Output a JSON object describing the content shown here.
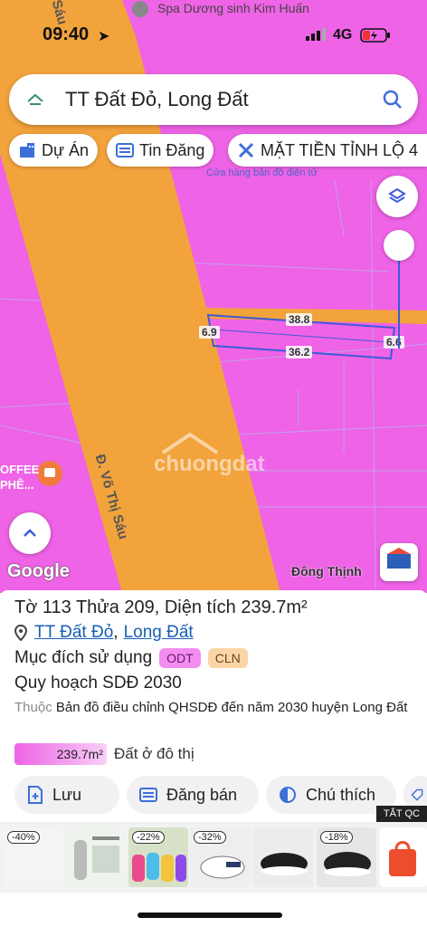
{
  "status": {
    "time": "09:40",
    "network": "4G"
  },
  "map": {
    "spa_label": "Spa Dương sinh Kim Huấn",
    "shop_label": "Cửa hàng bản đồ điện tử",
    "road_label": "Đ. Võ Thị Sáu",
    "road_label_top": "Sáu",
    "coffee_label": "OFFEE\nPHÊ...",
    "dim_top": "38.8",
    "dim_bottom": "36.2",
    "dim_left": "6.9",
    "dim_right": "6.6",
    "google": "Google",
    "attribution": "Đông Thịnh",
    "watermark": "chuongdat"
  },
  "search": {
    "query": "TT Đất Đỏ, Long Đất"
  },
  "chips": [
    {
      "label": "Dự Án"
    },
    {
      "label": "Tin Đăng"
    },
    {
      "label": "MẶT TIỀN TỈNH LỘ 4"
    }
  ],
  "panel": {
    "title": "Tờ 113 Thửa 209, Diện tích 239.7m²",
    "location_town": "TT Đất Đỏ",
    "location_district": "Long Đất",
    "purpose_label": "Mục đích sử dụng",
    "tags": [
      "ODT",
      "CLN"
    ],
    "plan": "Quy hoạch SDĐ 2030",
    "desc_prefix": "Thuộc",
    "desc_text": "Bản đồ điều chỉnh QHSDĐ đến năm 2030 huyện Long Đất",
    "area_value": "239.7m²",
    "area_label": "Đất ở đô thị",
    "actions": [
      "Lưu",
      "Đăng bán",
      "Chú thích"
    ]
  },
  "ads": {
    "close_label": "TẮT QC",
    "discounts": [
      "-40%",
      "-22%",
      "-32%",
      "-18%"
    ]
  },
  "colors": {
    "land_pink": "#ef63e6",
    "road_orange": "#f3a33c",
    "link_blue": "#1a5fb4"
  }
}
